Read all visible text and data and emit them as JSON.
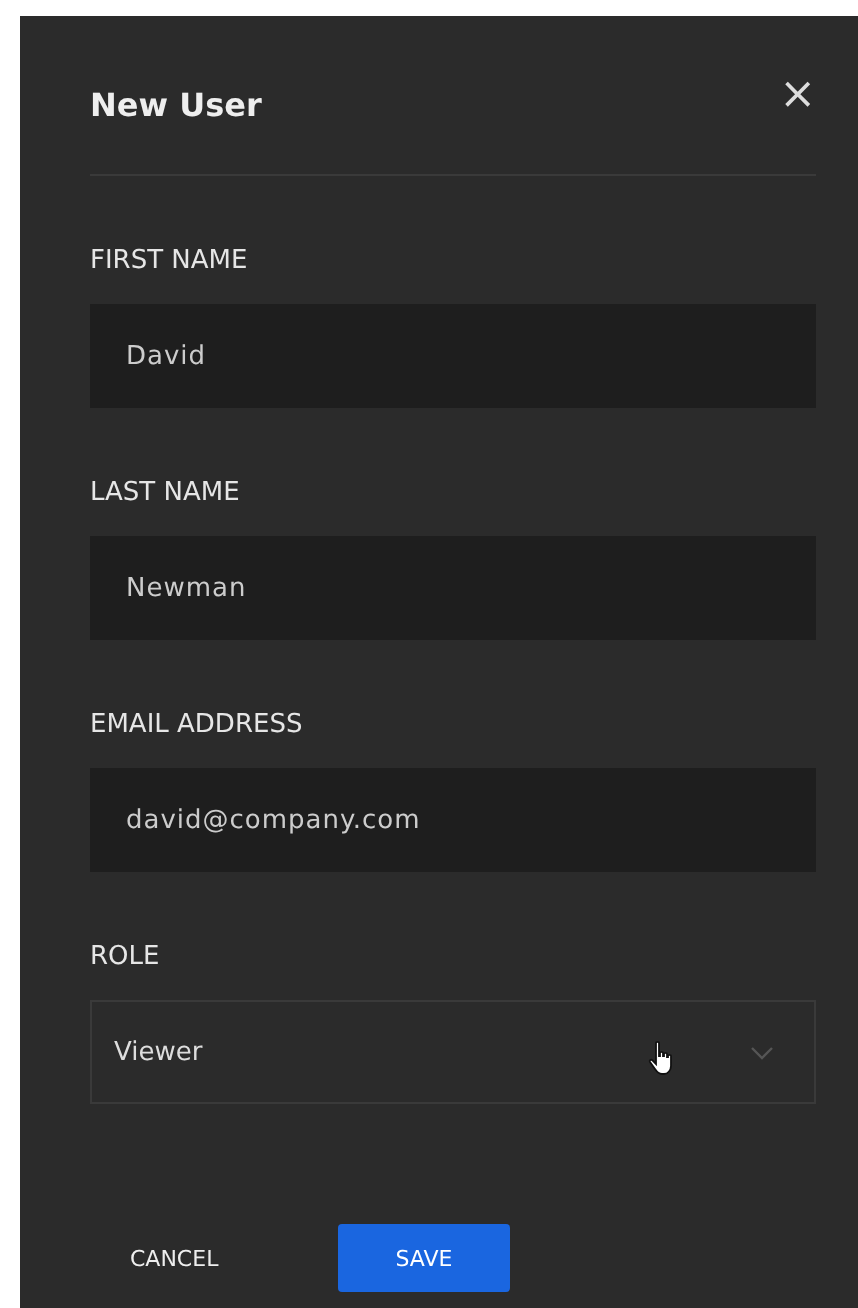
{
  "dialog": {
    "title": "New User",
    "close": "×"
  },
  "fields": [
    {
      "kind": "text",
      "label": "FIRST NAME",
      "value": "David"
    },
    {
      "kind": "text",
      "label": "LAST NAME",
      "value": "Newman"
    },
    {
      "kind": "text",
      "label": "EMAIL ADDRESS",
      "value": "david@company.com"
    },
    {
      "kind": "select",
      "label": "ROLE",
      "value": "Viewer"
    }
  ],
  "buttons": [
    {
      "kind": "text",
      "label": "CANCEL"
    },
    {
      "kind": "primary",
      "label": "SAVE"
    }
  ]
}
